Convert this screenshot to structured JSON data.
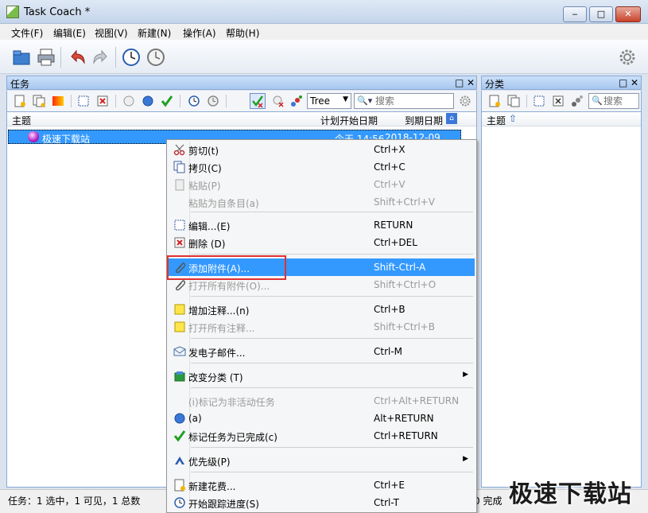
{
  "window": {
    "title": "Task Coach *",
    "minimize": "‒",
    "maximize": "□",
    "close": "✕"
  },
  "menubar": [
    "文件(F)",
    "编辑(E)",
    "视图(V)",
    "新建(N)",
    "操作(A)",
    "帮助(H)"
  ],
  "tasks_pane": {
    "title": "任务",
    "view_mode": "Tree",
    "search_placeholder": "搜索",
    "columns": {
      "subject": "主题",
      "planned_start": "计划开始日期",
      "due": "到期日期"
    },
    "rows": [
      {
        "subject": "极速下载站",
        "planned_start": "今天 14:56",
        "due": "2018-12-09 18:0"
      }
    ]
  },
  "categories_pane": {
    "title": "分类",
    "search_placeholder": "搜索",
    "columns": {
      "subject": "主题"
    }
  },
  "context_menu": {
    "items": [
      {
        "label": "剪切(t)",
        "shortcut": "Ctrl+X",
        "enabled": true,
        "icon": "scissors-icon"
      },
      {
        "label": "拷贝(C)",
        "shortcut": "Ctrl+C",
        "enabled": true,
        "icon": "copy-icon"
      },
      {
        "label": "粘贴(P)",
        "shortcut": "Ctrl+V",
        "enabled": false,
        "icon": "paste-icon"
      },
      {
        "label": "粘贴为自条目(a)",
        "shortcut": "Shift+Ctrl+V",
        "enabled": false,
        "icon": ""
      },
      {
        "label": "编辑...(E)",
        "shortcut": "RETURN",
        "enabled": true,
        "icon": "edit-icon"
      },
      {
        "label": "删除 (D)",
        "shortcut": "Ctrl+DEL",
        "enabled": true,
        "icon": "delete-icon"
      },
      {
        "label": "添加附件(A)...",
        "shortcut": "Shift-Ctrl-A",
        "enabled": true,
        "icon": "paperclip-icon"
      },
      {
        "label": "打开所有附件(O)...",
        "shortcut": "Shift+Ctrl+O",
        "enabled": false,
        "icon": "paperclip-icon"
      },
      {
        "label": "增加注释...(n)",
        "shortcut": "Ctrl+B",
        "enabled": true,
        "icon": "note-icon"
      },
      {
        "label": "打开所有注释...",
        "shortcut": "Shift+Ctrl+B",
        "enabled": false,
        "icon": "note-icon"
      },
      {
        "label": "发电子邮件...",
        "shortcut": "Ctrl-M",
        "enabled": true,
        "icon": "email-icon"
      },
      {
        "label": "改变分类 (T)",
        "shortcut": "",
        "enabled": true,
        "icon": "category-icon",
        "submenu": true
      },
      {
        "label": "(i)标记为非活动任务",
        "shortcut": "Ctrl+Alt+RETURN",
        "enabled": false,
        "icon": "inactive-icon"
      },
      {
        "label": "(a)",
        "shortcut": "Alt+RETURN",
        "enabled": true,
        "icon": "active-icon"
      },
      {
        "label": "标记任务为已完成(c)",
        "shortcut": "Ctrl+RETURN",
        "enabled": true,
        "icon": "checkmark-icon"
      },
      {
        "label": "优先级(P)",
        "shortcut": "",
        "enabled": true,
        "icon": "priority-icon",
        "submenu": true
      },
      {
        "label": "新建花费...",
        "shortcut": "Ctrl+E",
        "enabled": true,
        "icon": "new-effort-icon"
      },
      {
        "label": "开始跟踪进度(S)",
        "shortcut": "Ctrl-T",
        "enabled": true,
        "icon": "clock-icon"
      }
    ],
    "highlighted_index": 6
  },
  "status_bar": {
    "left": "任务：1 选中，1 可见，1 总数",
    "right": "0 完成"
  },
  "watermark": "极速下载站",
  "colors": {
    "selection": "#3399ff",
    "pane_header": "#a6c7ee",
    "highlight_box": "#e03131"
  }
}
